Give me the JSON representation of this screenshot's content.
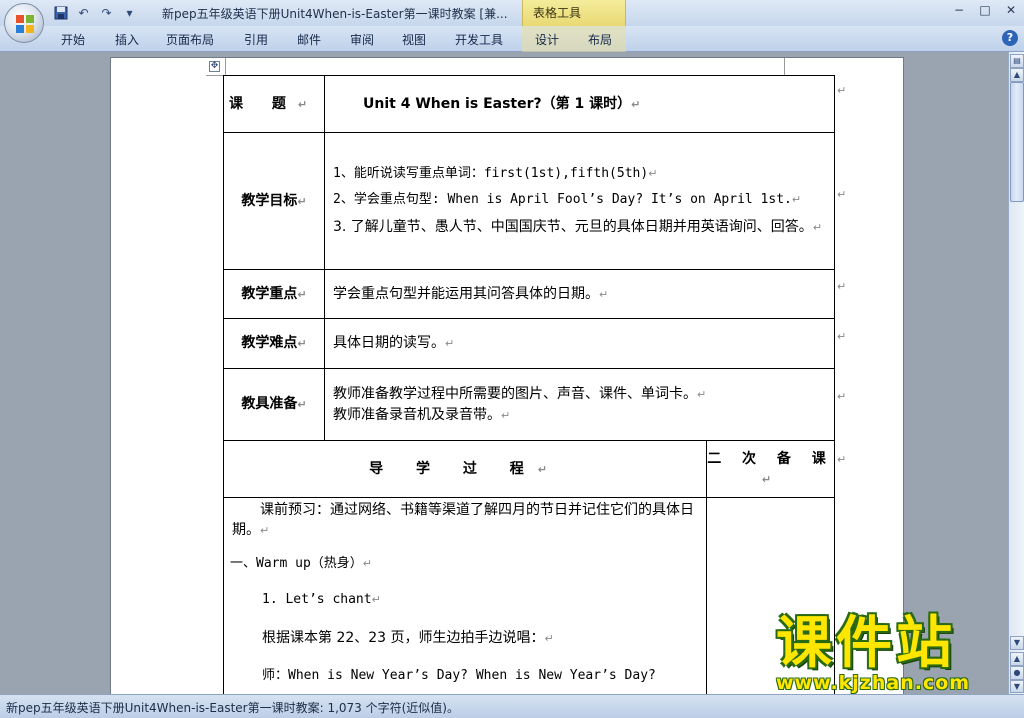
{
  "window": {
    "title": "新pep五年级英语下册Unit4When-is-Easter第一课时教案 [兼...",
    "context_group": "表格工具",
    "controls": [
      "−",
      "□",
      "✕"
    ]
  },
  "qat": [
    "save-icon",
    "undo-icon",
    "redo-icon",
    "customize-icon"
  ],
  "ribbon": {
    "tabs": [
      "开始",
      "插入",
      "页面布局",
      "引用",
      "邮件",
      "审阅",
      "视图",
      "开发工具",
      "设计",
      "布局"
    ]
  },
  "lesson": {
    "topic_label": "课 题",
    "topic_value": "Unit 4  When is Easter?（第 1 课时）",
    "goals_label": "教学目标",
    "goals": [
      "1、能听说读写重点单词：first(1st),fifth(5th)",
      "2、学会重点句型: When is April Fool’s Day? It’s on April 1st.",
      "3. 了解儿童节、愚人节、中国国庆节、元旦的具体日期并用英语询问、回答。"
    ],
    "key_label": "教学重点",
    "key_value": "学会重点句型并能运用其问答具体的日期。",
    "difficult_label": "教学难点",
    "difficult_value": "具体日期的读写。",
    "tools_label": "教具准备",
    "tools": [
      "教师准备教学过程中所需要的图片、声音、课件、单词卡。",
      "教师准备录音机及录音带。"
    ],
    "process_header": "导 学 过 程",
    "second_header": "二 次 备 课",
    "process": [
      "课前预习：通过网络、书籍等渠道了解四月的节日并记住它们的具体日期。",
      "一、Warm up（热身）",
      "1.  Let’s chant",
      "根据课本第 22、23 页，师生边拍手边说唱：",
      "师：When is New Year’s Day?  When is New Year’s Day?"
    ]
  },
  "status": {
    "text": "新pep五年级英语下册Unit4When-is-Easter第一课时教案: 1,073 个字符(近似值)。"
  },
  "watermark": {
    "cn": "课件站",
    "url": "www.kjzhan.com"
  }
}
